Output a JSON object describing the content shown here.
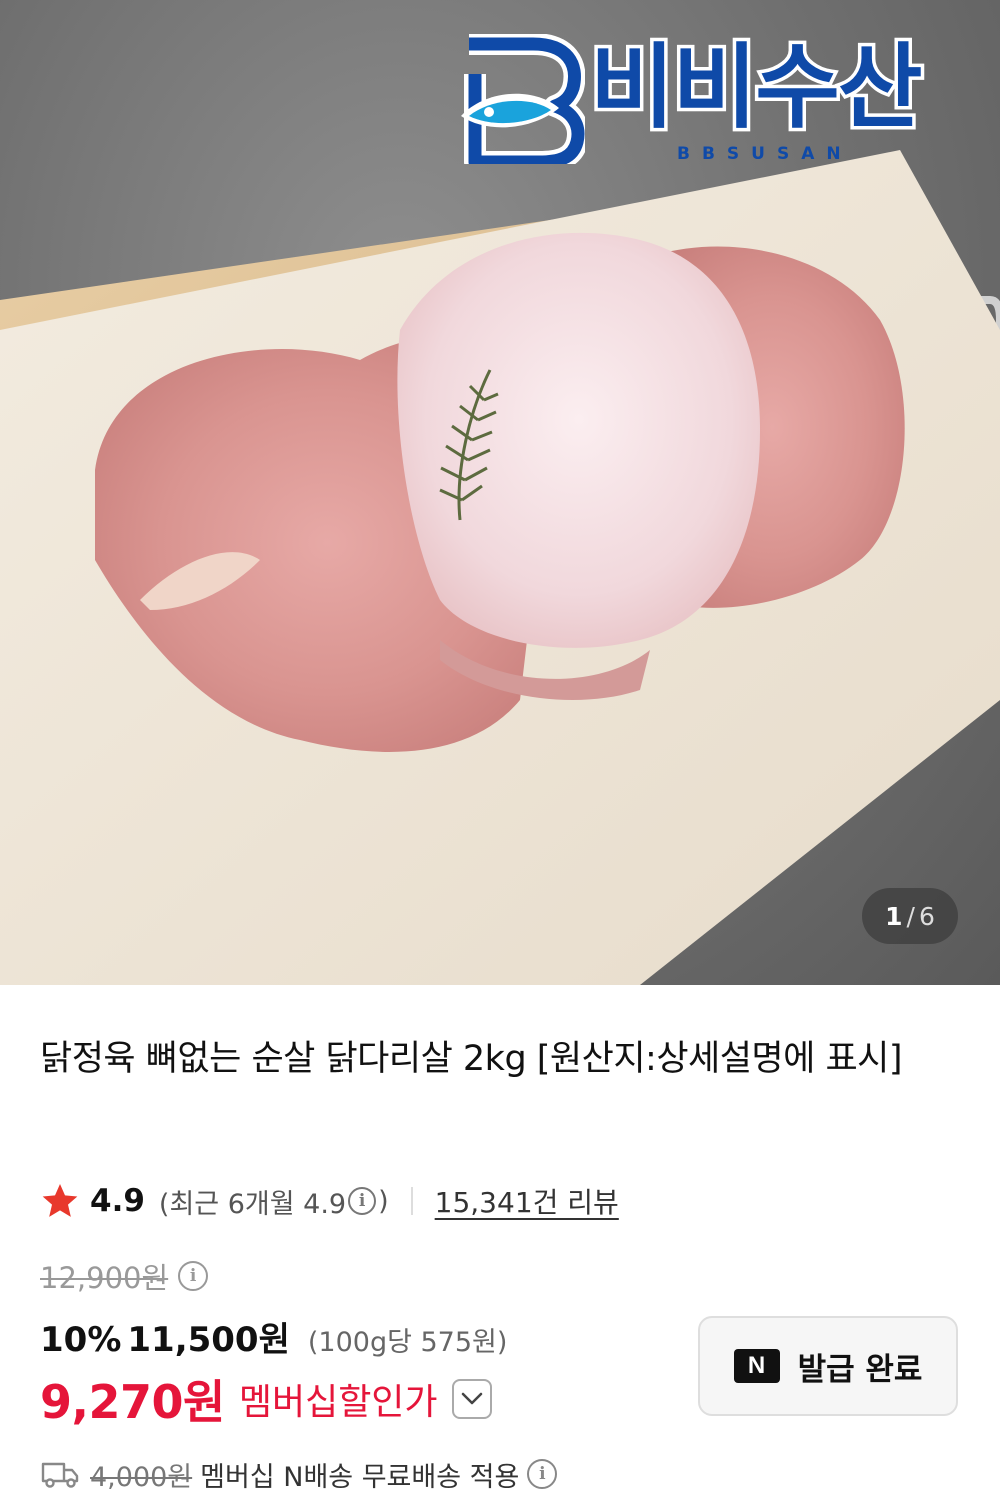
{
  "image": {
    "brand_logo_text": "비비수산",
    "brand_logo_subtext": "BBSUSAN",
    "pager": {
      "current": "1",
      "separator": "/",
      "total": "6"
    }
  },
  "product": {
    "title": "닭정육 뼈없는 순살 닭다리살 2kg [원산지:상세설명에 표시]",
    "rating": "4.9",
    "recent_rating": "(최근 6개월 4.9",
    "recent_rating_close": ")",
    "review_count": "15,341건 리뷰",
    "original_price": "12,900원",
    "discount_rate": "10%",
    "sale_price": "11,500원",
    "unit_price": "(100g당 575원)",
    "member_price": "9,270원",
    "member_label": "멤버십할인가",
    "coupon_badge": "N",
    "coupon_label": "발급 완료",
    "shipping_original": "4,000원",
    "shipping_text": "멤버십 N배송 무료배송 적용"
  },
  "icons": {
    "star": "star-icon",
    "info": "info-icon",
    "chevron": "chevron-down-icon",
    "truck": "truck-icon"
  },
  "colors": {
    "accent_red": "#e5153a",
    "star_red": "#e8382c",
    "brand_blue": "#0f4aa8"
  }
}
